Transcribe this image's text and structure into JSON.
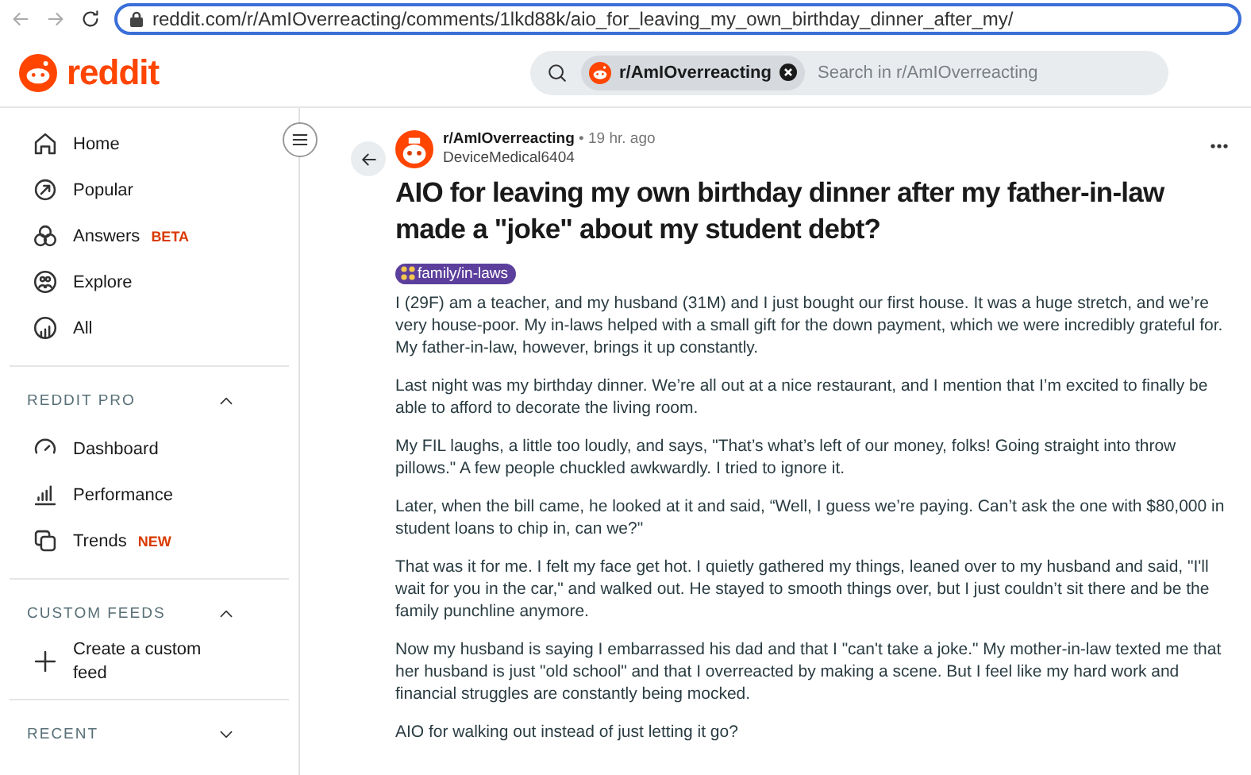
{
  "browser": {
    "url": "reddit.com/r/AmIOverreacting/comments/1lkd88k/aio_for_leaving_my_own_birthday_dinner_after_my/"
  },
  "header": {
    "logo_text": "reddit",
    "search": {
      "community": "r/AmIOverreacting",
      "placeholder": "Search in r/AmIOverreacting"
    }
  },
  "sidebar": {
    "items": [
      {
        "label": "Home"
      },
      {
        "label": "Popular"
      },
      {
        "label": "Answers",
        "badge": "BETA"
      },
      {
        "label": "Explore"
      },
      {
        "label": "All"
      }
    ],
    "sections": [
      {
        "title": "REDDIT PRO",
        "expanded": true,
        "items": [
          {
            "label": "Dashboard"
          },
          {
            "label": "Performance"
          },
          {
            "label": "Trends",
            "badge": "NEW"
          }
        ]
      },
      {
        "title": "CUSTOM FEEDS",
        "expanded": true,
        "items": [
          {
            "label": "Create a custom feed"
          }
        ]
      },
      {
        "title": "RECENT",
        "expanded": false
      }
    ]
  },
  "post": {
    "subreddit": "r/AmIOverreacting",
    "time": "• 19 hr. ago",
    "author": "DeviceMedical6404",
    "title": "AIO for leaving my own birthday dinner after my father-in-law made a \"joke\" about my student debt?",
    "flair": "family/in-laws",
    "paragraphs": [
      "I (29F) am a teacher, and my husband (31M) and I just bought our first house. It was a huge stretch, and we’re very house-poor. My in-laws helped with a small gift for the down payment, which we were incredibly grateful for. My father-in-law, however, brings it up constantly.",
      "Last night was my birthday dinner. We’re all out at a nice restaurant, and I mention that I’m excited to finally be able to afford to decorate the living room.",
      "My FIL laughs, a little too loudly, and says, \"That’s what’s left of our money, folks! Going straight into throw pillows.\" A few people chuckled awkwardly. I tried to ignore it.",
      "Later, when the bill came, he looked at it and said, “Well, I guess we’re paying. Can’t ask the one with $80,000 in student loans to chip in, can we?\"",
      "That was it for me. I felt my face get hot. I quietly gathered my things, leaned over to my husband and said, \"I'll wait for you in the car,\" and walked out. He stayed to smooth things over, but I just couldn’t sit there and be the family punchline anymore.",
      "Now my husband is saying I embarrassed his dad and that I \"can't take a joke.\" My mother-in-law texted me that her husband is just \"old school\" and that I overreacted by making a scene. But I feel like my hard work and financial struggles are constantly being mocked.",
      "AIO for walking out instead of just letting it go?"
    ]
  }
}
